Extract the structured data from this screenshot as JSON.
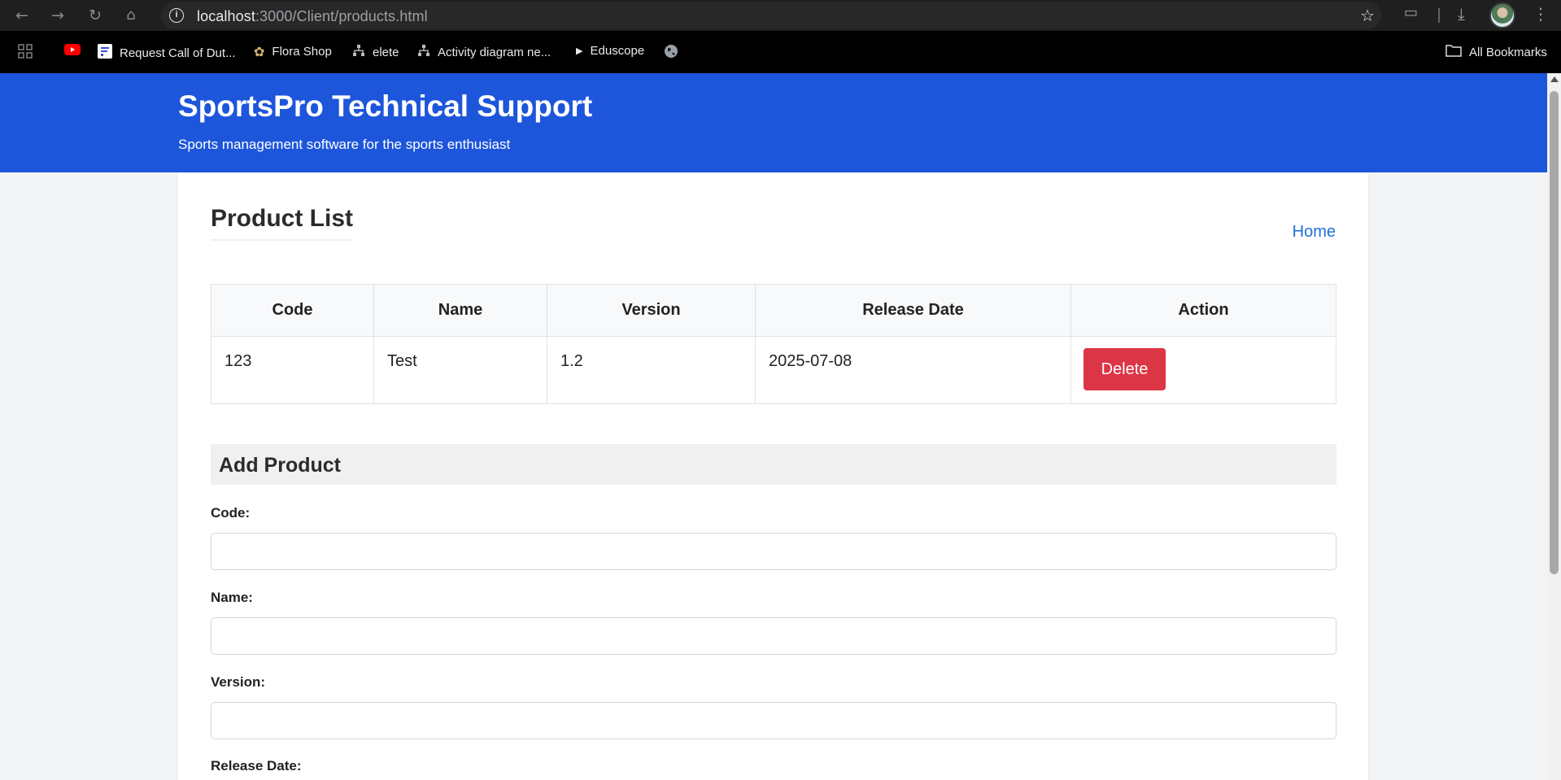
{
  "browser": {
    "url_host": "localhost",
    "url_rest": ":3000/Client/products.html",
    "bookmarks": [
      {
        "label": "",
        "icon": "youtube-icon"
      },
      {
        "label": "Request Call of Dut...",
        "icon": "doc-icon"
      },
      {
        "label": "Flora Shop",
        "icon": "flower-icon"
      },
      {
        "label": "elete",
        "icon": "sitemap-icon"
      },
      {
        "label": "Activity diagram ne...",
        "icon": "sitemap-icon"
      },
      {
        "label": "Eduscope",
        "icon": "play-icon"
      },
      {
        "label": "",
        "icon": "globe-icon"
      }
    ],
    "all_bookmarks": "All Bookmarks"
  },
  "header": {
    "title": "SportsPro Technical Support",
    "subtitle": "Sports management software for the sports enthusiast"
  },
  "main": {
    "title": "Product List",
    "home_link": "Home",
    "table": {
      "headers": [
        "Code",
        "Name",
        "Version",
        "Release Date",
        "Action"
      ],
      "rows": [
        {
          "code": "123",
          "name": "Test",
          "version": "1.2",
          "release_date": "2025-07-08",
          "action": "Delete"
        }
      ]
    },
    "add_product": {
      "title": "Add Product",
      "code_label": "Code:",
      "name_label": "Name:",
      "version_label": "Version:",
      "release_date_label": "Release Date:",
      "code_value": "",
      "name_value": "",
      "version_value": ""
    }
  },
  "colors": {
    "header_bg": "#1d56db",
    "delete_btn": "#dc3545",
    "link": "#1d6fd8"
  }
}
